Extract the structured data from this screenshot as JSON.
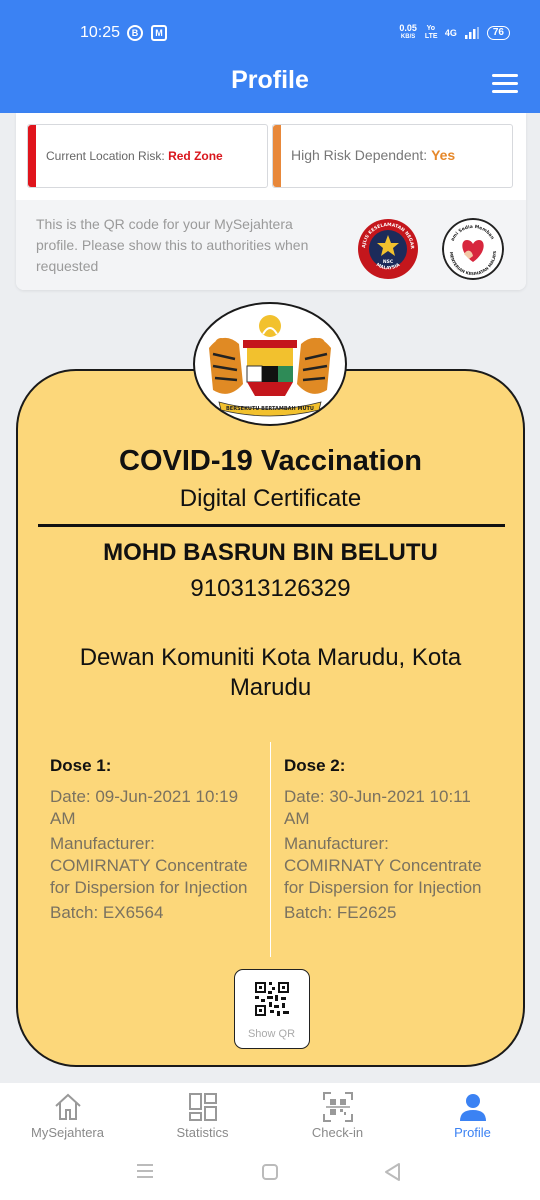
{
  "status_bar": {
    "time": "10:25",
    "notif_icons": [
      "b-circle-icon",
      "m-app-icon"
    ],
    "speed_value": "0.05",
    "speed_unit": "KB/S",
    "network": "Yo LTE",
    "signal_label": "4G",
    "battery": "76"
  },
  "header": {
    "title": "Profile"
  },
  "risk": {
    "location_label": "Current Location Risk:",
    "location_value": "Red Zone",
    "dependent_label": "High Risk Dependent:",
    "dependent_value": "Yes",
    "location_color": "#e0141c",
    "dependent_color": "#e8883a"
  },
  "qr_info": {
    "text": "This is the QR code for your MySejahtera profile. Please show this to authorities when requested",
    "logo1": {
      "top_text": "MAJLIS KESELAMATAN NEGARA",
      "center_text": "NSC",
      "bottom_text": "MALAYSIA"
    },
    "logo2": {
      "top_text": "Kami Sedia Membantu",
      "bottom_text": "KEMENTERIAN KESIHATAN MALAYSIA"
    }
  },
  "certificate": {
    "emblem_motto": "BERSEKUTU BERTAMBAH MUTU",
    "title": "COVID-19 Vaccination",
    "subtitle": "Digital Certificate",
    "name": "MOHD BASRUN BIN BELUTU",
    "id_number": "910313126329",
    "location": "Dewan Komuniti Kota Marudu, Kota Marudu",
    "doses": [
      {
        "title": "Dose 1:",
        "date": "Date: 09-Jun-2021 10:19 AM",
        "manufacturer": "Manufacturer: COMIRNATY Concentrate for Dispersion for Injection",
        "batch": "Batch: EX6564"
      },
      {
        "title": "Dose 2:",
        "date": "Date: 30-Jun-2021 10:11 AM",
        "manufacturer": "Manufacturer: COMIRNATY Concentrate for Dispersion for Injection",
        "batch": "Batch: FE2625"
      }
    ],
    "show_qr_label": "Show QR",
    "background_color": "#fcd77a"
  },
  "bottom_nav": {
    "items": [
      {
        "label": "MySejahtera",
        "icon": "home-icon",
        "active": false
      },
      {
        "label": "Statistics",
        "icon": "statistics-grid-icon",
        "active": false
      },
      {
        "label": "Check-in",
        "icon": "qr-scan-icon",
        "active": false
      },
      {
        "label": "Profile",
        "icon": "person-icon",
        "active": true
      }
    ],
    "active_color": "#3b82f3"
  },
  "system_nav": {
    "icons": [
      "recents-icon",
      "home-square-icon",
      "back-triangle-icon"
    ]
  },
  "theme": {
    "primary": "#3b82f3",
    "background": "#eceef1"
  }
}
